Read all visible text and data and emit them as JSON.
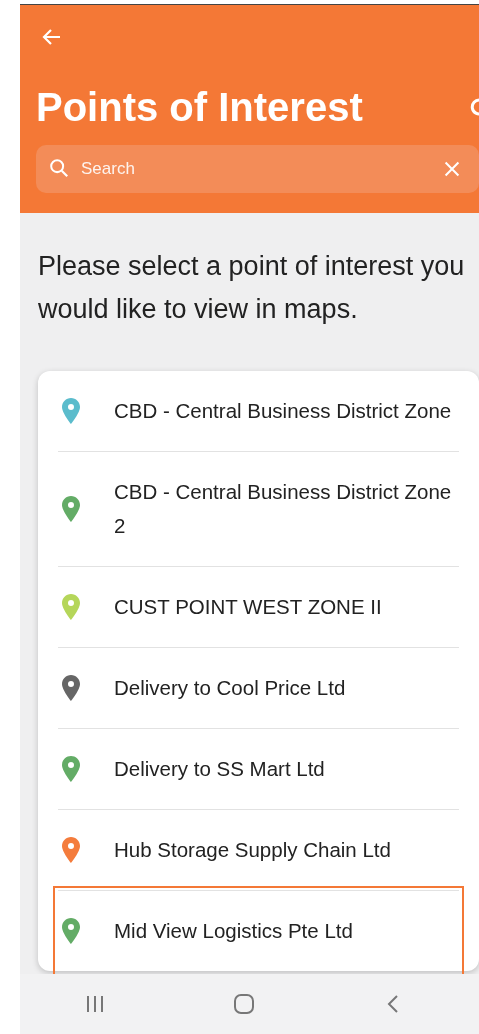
{
  "header": {
    "title": "Points of Interest",
    "search": {
      "placeholder": "Search"
    }
  },
  "instructions": "Please select a point of interest you would like to view in maps.",
  "points": [
    {
      "name": "CBD - Central Business District Zone",
      "color": "#5bbccc",
      "selected": false
    },
    {
      "name": "CBD - Central Business District Zone 2",
      "color": "#63ac66",
      "selected": false
    },
    {
      "name": "CUST POINT WEST ZONE II",
      "color": "#b5d65a",
      "selected": false
    },
    {
      "name": "Delivery to Cool Price Ltd",
      "color": "#666666",
      "selected": false
    },
    {
      "name": "Delivery to SS Mart Ltd",
      "color": "#63ac66",
      "selected": false
    },
    {
      "name": "Hub Storage Supply Chain Ltd",
      "color": "#f47c3c",
      "selected": false
    },
    {
      "name": "Mid View Logistics Pte Ltd",
      "color": "#63ac66",
      "selected": true
    }
  ]
}
